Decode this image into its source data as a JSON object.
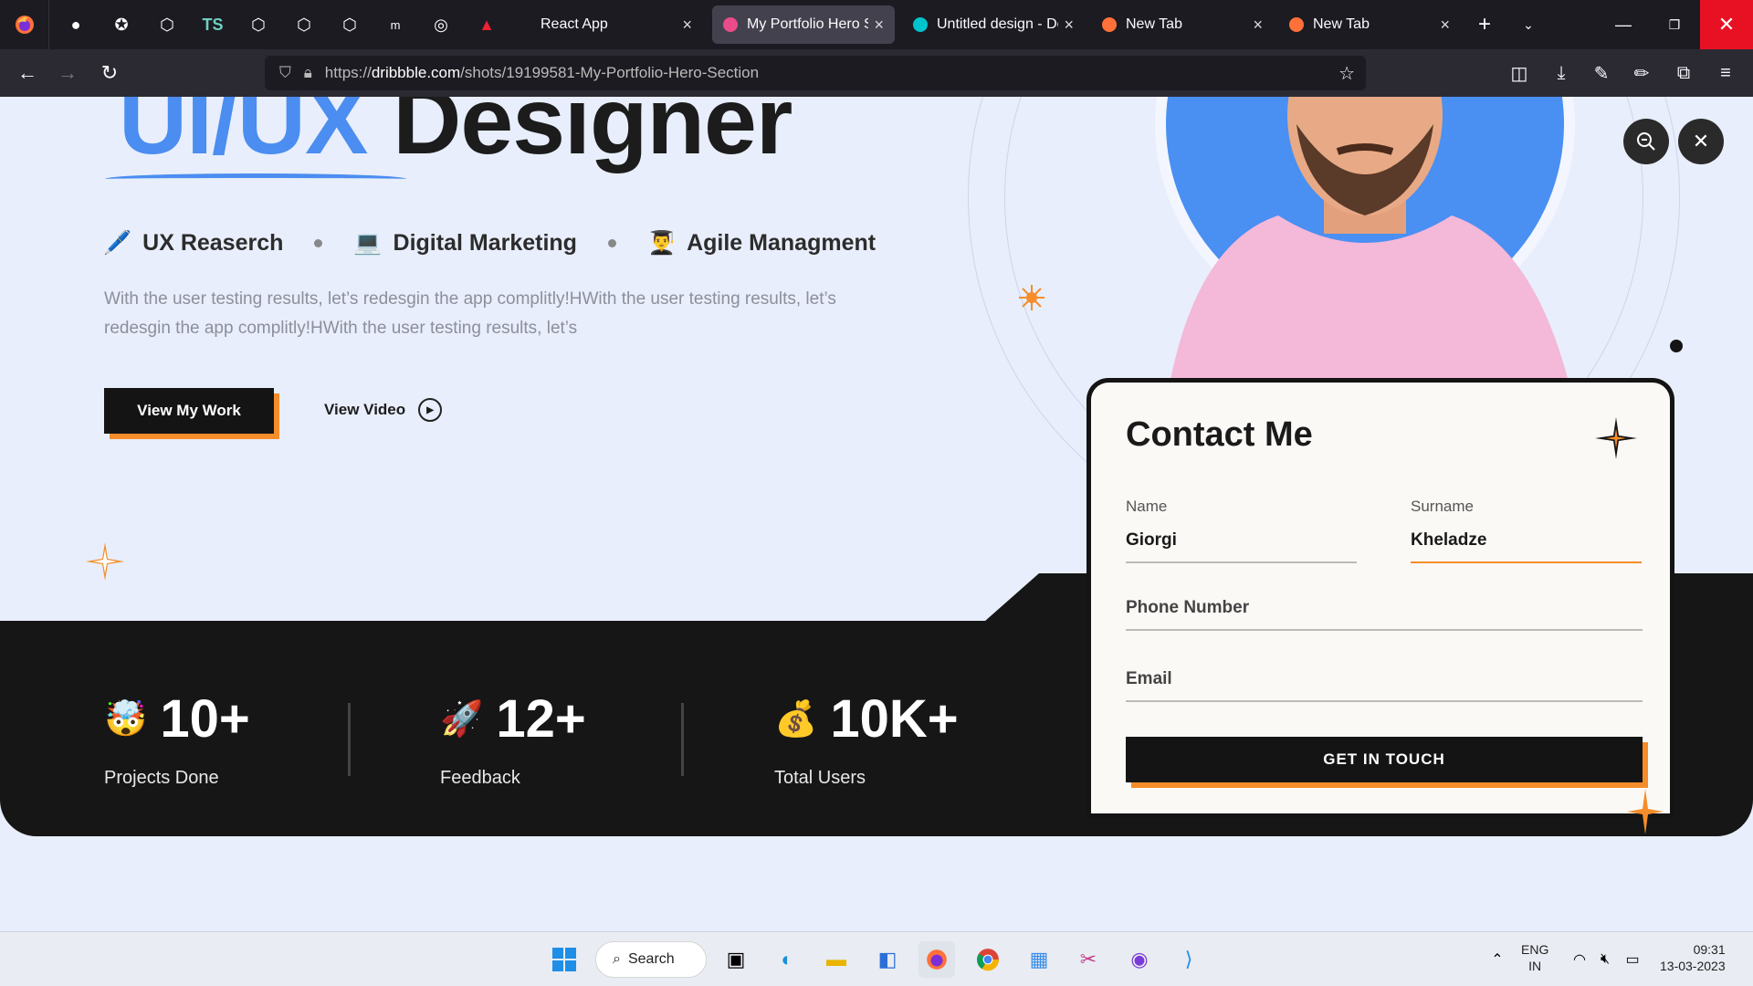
{
  "browser": {
    "tabs": [
      {
        "title": "React App",
        "active": false
      },
      {
        "title": "My Portfolio Hero Se",
        "active": true
      },
      {
        "title": "Untitled design - De",
        "active": false
      },
      {
        "title": "New Tab",
        "active": false
      },
      {
        "title": "New Tab",
        "active": false
      }
    ],
    "pinned_tabs": [
      "●",
      "✪",
      "⬡",
      "TS",
      "⬡",
      "⬡",
      "⬡",
      "m",
      "◎",
      "▲"
    ],
    "url_prefix": "https://",
    "url_host": "dribbble.com",
    "url_path": "/shots/19199581-My-Portfolio-Hero-Section"
  },
  "hero": {
    "title_accent": "UI/UX",
    "title_rest": " Designer",
    "skills": [
      {
        "emoji": "🖊️",
        "label": "UX Reaserch"
      },
      {
        "emoji": "💻",
        "label": "Digital Marketing"
      },
      {
        "emoji": "👨‍🎓",
        "label": "Agile Managment"
      }
    ],
    "description": "With the user testing results, let’s redesgin  the app complitly!HWith the user testing results, let’s redesgin  the app complitly!HWith the user testing results, let’s",
    "primary_button": "View My Work",
    "secondary_button": "View Video"
  },
  "stats": [
    {
      "emoji": "🤯",
      "value": "10+",
      "label": "Projects Done"
    },
    {
      "emoji": "🚀",
      "value": "12+",
      "label": "Feedback"
    },
    {
      "emoji": "💰",
      "value": "10K+",
      "label": "Total Users"
    }
  ],
  "contact": {
    "title": "Contact Me",
    "name_label": "Name",
    "name_value": "Giorgi",
    "surname_label": "Surname",
    "surname_value": "Kheladze",
    "phone_placeholder": "Phone Number",
    "email_placeholder": "Email",
    "submit": "GET IN TOUCH"
  },
  "taskbar": {
    "search_label": "Search",
    "lang_top": "ENG",
    "lang_bottom": "IN",
    "time": "09:31",
    "date": "13-03-2023"
  },
  "colors": {
    "accent_blue": "#4b8df0",
    "accent_orange": "#f58d2a",
    "dark": "#161616",
    "page_bg": "#e8eefb"
  }
}
